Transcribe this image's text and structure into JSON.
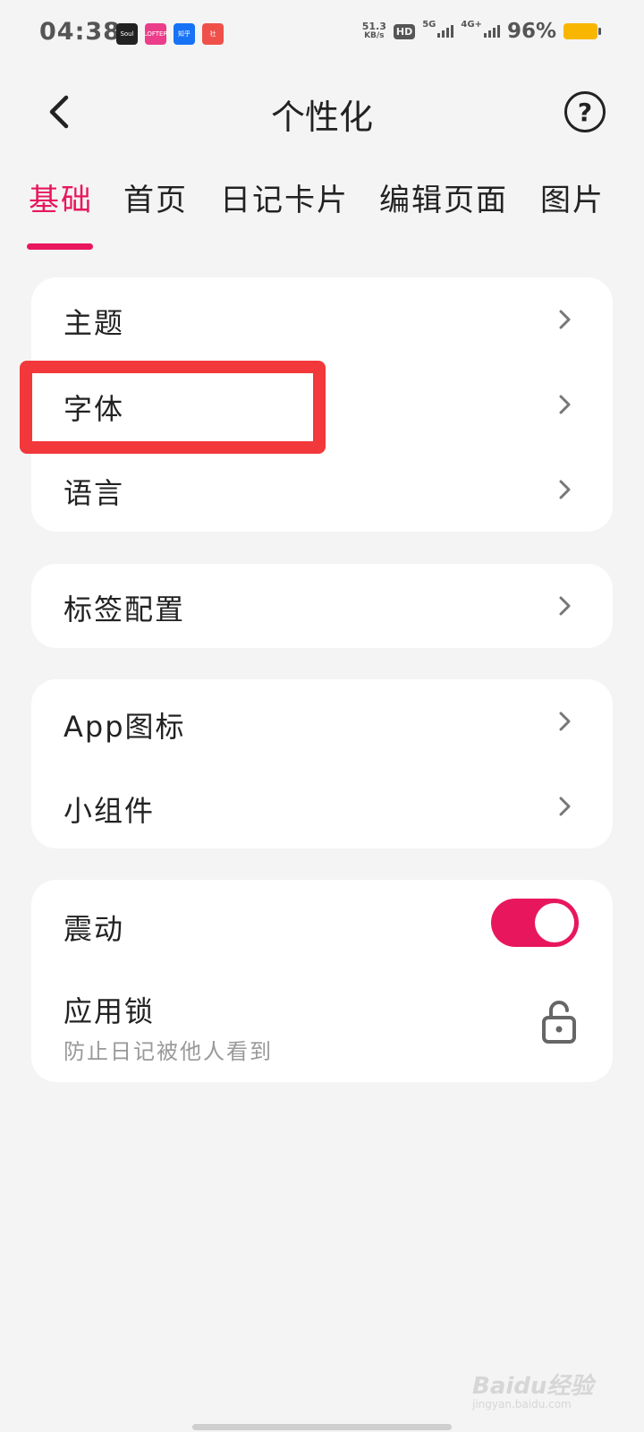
{
  "status_bar": {
    "time": "04:38",
    "net_speed_value": "51.3",
    "net_speed_unit": "KB/s",
    "hd_badge": "HD",
    "sim1_label": "5G",
    "sim2_label": "4G+",
    "battery_percent": "96%",
    "app_icon_1": "Soul",
    "app_icon_2": "LOFTER",
    "app_icon_3": "知乎",
    "app_icon_4": "社"
  },
  "header": {
    "title": "个性化",
    "help_label": "?"
  },
  "tabs": [
    {
      "label": "基础",
      "active": true
    },
    {
      "label": "首页",
      "active": false
    },
    {
      "label": "日记卡片",
      "active": false
    },
    {
      "label": "编辑页面",
      "active": false
    },
    {
      "label": "图片",
      "active": false
    }
  ],
  "group1": {
    "theme": "主题",
    "font": "字体",
    "language": "语言"
  },
  "group2": {
    "tag_config": "标签配置"
  },
  "group3": {
    "app_icon": "App图标",
    "widget": "小组件"
  },
  "group4": {
    "vibration": "震动",
    "vibration_on": true,
    "app_lock": "应用锁",
    "app_lock_sub": "防止日记被他人看到"
  },
  "watermark": {
    "text": "Baidu经验",
    "sub": "jingyan.baidu.com"
  },
  "colors": {
    "accent": "#e8175d",
    "highlight": "#f2383a",
    "background": "#f4f4f4",
    "card": "#ffffff"
  }
}
